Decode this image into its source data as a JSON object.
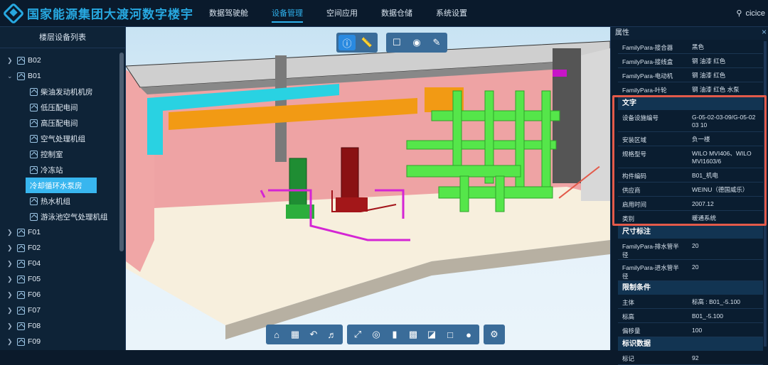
{
  "app": {
    "logo_text": "国家能源集团大渡河数字楼宇",
    "nav": [
      "数据驾驶舱",
      "设备管理",
      "空间应用",
      "数据仓储",
      "系统设置"
    ],
    "active_nav": "设备管理",
    "user": "cicice"
  },
  "sidebar": {
    "title": "楼层设备列表",
    "b02": "B02",
    "b01": "B01",
    "b01_children": [
      "柴油发动机机房",
      "低压配电间",
      "高压配电间",
      "空气处理机组",
      "控制室",
      "冷冻站",
      "冷却循环水泵房",
      "热水机组",
      "游泳池空气处理机组"
    ],
    "selected": "冷却循环水泵房",
    "floors": [
      "F01",
      "F02",
      "F04",
      "F05",
      "F06",
      "F07",
      "F08",
      "F09"
    ]
  },
  "toolbar_top": {
    "icons": [
      "info-icon",
      "ruler-icon",
      "bookmark-icon",
      "camera-icon",
      "pen-icon"
    ]
  },
  "toolbar_bottom": {
    "icons": [
      "home-icon",
      "frame-icon",
      "back-icon",
      "walk-icon",
      "explode-icon",
      "eye-icon",
      "section-icon",
      "cube-icon",
      "cube-top-icon",
      "cube-outline-icon",
      "palette-icon",
      "settings-icon"
    ]
  },
  "panel": {
    "title": "属性",
    "top_rows": [
      {
        "k": "FamilyPara-接合器",
        "v": "黑色"
      },
      {
        "k": "FamilyPara-接线盒",
        "v": "钢 油漆 红色"
      },
      {
        "k": "FamilyPara-电动机",
        "v": "钢 油漆 红色"
      },
      {
        "k": "FamilyPara-叶轮",
        "v": "钢 油漆 红色 水泵"
      }
    ],
    "text_section": "文字",
    "text_rows": [
      {
        "k": "设备设施编号",
        "v": "G-05-02-03-09/G-05-02 03 10"
      },
      {
        "k": "安装区域",
        "v": "负一楼"
      },
      {
        "k": "规格型号",
        "v": "WILO MVI406、WILO MVI1603/6"
      },
      {
        "k": "构件编码",
        "v": "B01_机电"
      },
      {
        "k": "供应商",
        "v": "WEINU（德国威乐）"
      },
      {
        "k": "启用时间",
        "v": "2007.12"
      },
      {
        "k": "类别",
        "v": "暖通系统"
      }
    ],
    "dim_section": "尺寸标注",
    "dim_rows": [
      {
        "k": "FamilyPara-排水管半径",
        "v": "20"
      },
      {
        "k": "FamilyPara-进水管半径",
        "v": "20"
      }
    ],
    "constraint_section": "限制条件",
    "constraint_rows": [
      {
        "k": "主体",
        "v": "标高 : B01_-5.100"
      },
      {
        "k": "标高",
        "v": "B01_-5.100"
      },
      {
        "k": "偏移量",
        "v": "100"
      }
    ],
    "id_section": "标识数据",
    "id_rows": [
      {
        "k": "标记",
        "v": "92"
      }
    ]
  },
  "colors": {
    "accent": "#2fb2ee",
    "highlight": "#e35a4a",
    "wall": "#e59a9a",
    "pipe_green": "#55e64a",
    "duct_cyan": "#2ad0e0",
    "duct_orange": "#f29a14"
  }
}
